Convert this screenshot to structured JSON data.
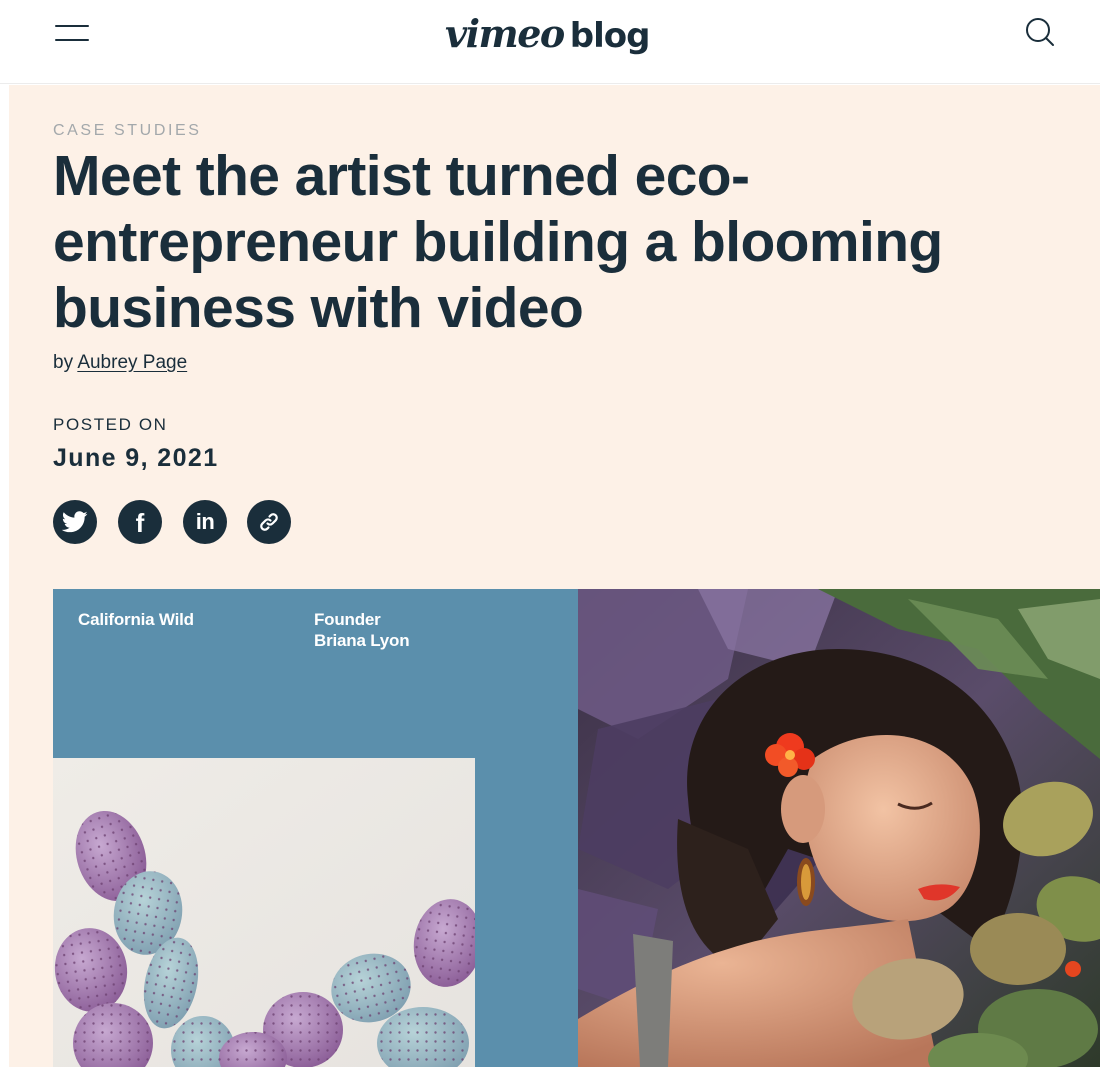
{
  "header": {
    "logo_brand": "vimeo",
    "logo_suffix": "blog",
    "menu_icon": "hamburger-menu-icon",
    "search_icon": "search-icon"
  },
  "article": {
    "category": "CASE STUDIES",
    "title": "Meet the artist turned eco-entrepreneur building a blooming business with video",
    "byline_prefix": "by",
    "author": "Aubrey Page",
    "posted_label": "POSTED ON",
    "posted_date": "June 9, 2021"
  },
  "share": {
    "icons": [
      "twitter-icon",
      "facebook-icon",
      "linkedin-icon",
      "copy-link-icon"
    ],
    "facebook_glyph": "f",
    "linkedin_glyph": "in"
  },
  "feature": {
    "company": "California Wild",
    "founder_role": "Founder",
    "founder_name": "Briana Lyon"
  },
  "colors": {
    "ink": "#1a2e3b",
    "hero_background": "#fdf1e7",
    "panel_blue": "#5b8fac",
    "eyebrow_gray": "#a3a8ab"
  }
}
